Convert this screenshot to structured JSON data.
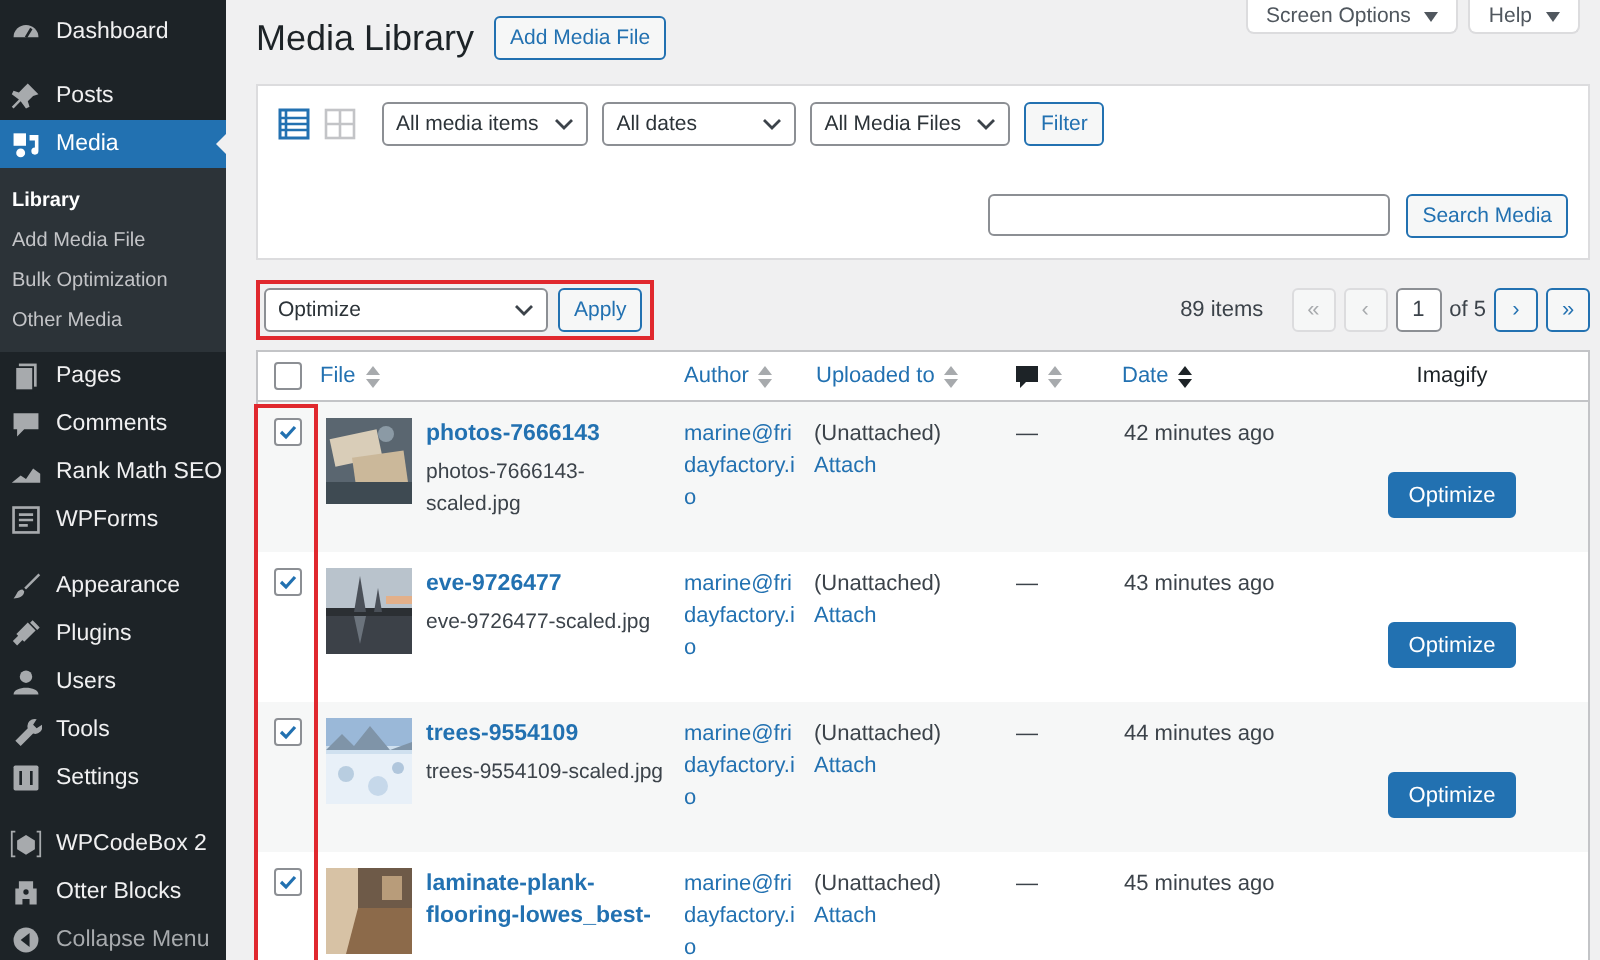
{
  "sidebar": {
    "groups": [
      [
        {
          "label": "Dashboard",
          "selected": false
        }
      ],
      [
        {
          "label": "Posts",
          "selected": false
        },
        {
          "label": "Media",
          "selected": true,
          "children": [
            {
              "label": "Library",
              "selected": true
            },
            {
              "label": "Add Media File",
              "selected": false
            },
            {
              "label": "Bulk Optimization",
              "selected": false
            },
            {
              "label": "Other Media",
              "selected": false
            }
          ]
        },
        {
          "label": "Pages",
          "selected": false
        },
        {
          "label": "Comments",
          "selected": false
        },
        {
          "label": "Rank Math SEO",
          "selected": false
        },
        {
          "label": "WPForms",
          "selected": false
        }
      ],
      [
        {
          "label": "Appearance",
          "selected": false
        },
        {
          "label": "Plugins",
          "selected": false
        },
        {
          "label": "Users",
          "selected": false
        },
        {
          "label": "Tools",
          "selected": false
        },
        {
          "label": "Settings",
          "selected": false
        }
      ],
      [
        {
          "label": "WPCodeBox 2",
          "selected": false
        },
        {
          "label": "Otter Blocks",
          "selected": false
        }
      ]
    ],
    "collapse": {
      "label": "Collapse Menu"
    }
  },
  "header": {
    "title": "Media Library",
    "add_button": "Add Media File",
    "screen_options": "Screen Options",
    "help": "Help"
  },
  "filters": {
    "view_modes": [
      {
        "selected": true
      },
      {
        "selected": false
      }
    ],
    "selects": [
      "All media items",
      "All dates",
      "All Media Files"
    ],
    "filter_button": "Filter",
    "search_button": "Search Media"
  },
  "bulk_actions": {
    "value": "Optimize",
    "apply": "Apply",
    "highlighted": true
  },
  "pagination": {
    "count": "89 items",
    "first": {
      "label": "«",
      "disabled": true
    },
    "prev": {
      "label": "‹",
      "disabled": true
    },
    "page": "1",
    "of": "of 5",
    "next": {
      "label": "›",
      "disabled": false
    },
    "last": {
      "label": "»",
      "disabled": false
    }
  },
  "table": {
    "select_all": {
      "checked": false
    },
    "checkbox_column_highlighted": true,
    "columns": [
      {
        "kind": "sortable",
        "label": "File",
        "sorted": false
      },
      {
        "kind": "sortable",
        "label": "Author",
        "sorted": false
      },
      {
        "kind": "sortable",
        "label": "Uploaded to",
        "sorted": false
      },
      {
        "kind": "comments",
        "sorted": false
      },
      {
        "kind": "sortable",
        "label": "Date",
        "sorted": true
      },
      {
        "kind": "plain",
        "label": "Imagify"
      }
    ],
    "rows": [
      {
        "checked": true,
        "title": "photos-7666143",
        "filename": "photos-7666143-scaled.jpg",
        "author": "marine@fridayfactory.io",
        "uploaded": "(Unattached)",
        "attach": "Attach",
        "comments": "—",
        "date": "42 minutes ago",
        "action": "Optimize"
      },
      {
        "checked": true,
        "title": "eve-9726477",
        "filename": "eve-9726477-scaled.jpg",
        "author": "marine@fridayfactory.io",
        "uploaded": "(Unattached)",
        "attach": "Attach",
        "comments": "—",
        "date": "43 minutes ago",
        "action": "Optimize"
      },
      {
        "checked": true,
        "title": "trees-9554109",
        "filename": "trees-9554109-scaled.jpg",
        "author": "marine@fridayfactory.io",
        "uploaded": "(Unattached)",
        "attach": "Attach",
        "comments": "—",
        "date": "44 minutes ago",
        "action": "Optimize"
      },
      {
        "checked": true,
        "title": "laminate-plank-flooring-lowes_best-",
        "author": "marine@fridayfactory.io",
        "uploaded": "(Unattached)",
        "attach": "Attach",
        "comments": "—",
        "date": "45 minutes ago"
      }
    ]
  }
}
